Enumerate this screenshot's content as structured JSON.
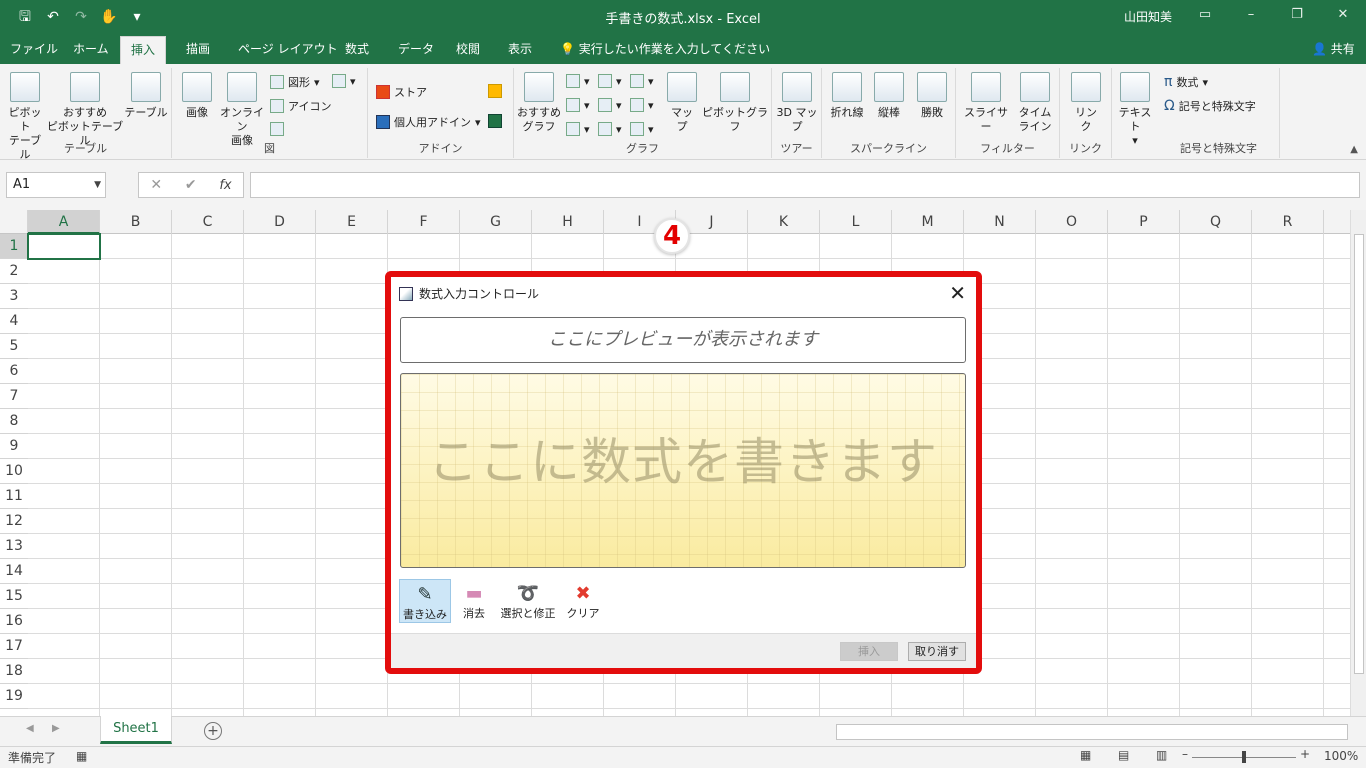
{
  "titlebar": {
    "title": "手書きの数式.xlsx  -  Excel",
    "user": "山田知美"
  },
  "tabs": [
    "ファイル",
    "ホーム",
    "挿入",
    "描画",
    "ページ レイアウト",
    "数式",
    "データ",
    "校閲",
    "表示"
  ],
  "tellme": "実行したい作業を入力してください",
  "share": "共有",
  "ribbon": {
    "groups": {
      "table": "テーブル",
      "illustrations": "図",
      "addins": "アドイン",
      "charts": "グラフ",
      "tours": "ツアー",
      "sparklines": "スパークライン",
      "filters": "フィルター",
      "links": "リンク",
      "symbols": "記号と特殊文字"
    },
    "buttons": {
      "pivot": "ピボット\nテーブル",
      "recpivot": "おすすめ\nピボットテーブル",
      "table": "テーブル",
      "picture": "画像",
      "online": "オンライン\n画像",
      "shapes": "図形",
      "icons": "アイコン",
      "store": "ストア",
      "myaddins": "個人用アドイン",
      "recchart": "おすすめ\nグラフ",
      "map": "マッ\nプ",
      "pivotchart": "ピボットグラフ",
      "map3d": "3D マッ\nプ",
      "line": "折れ線",
      "column": "縦棒",
      "winloss": "勝敗",
      "slicer": "スライサー",
      "timeline": "タイム\nライン",
      "link": "リン\nク",
      "text": "テキスト",
      "equation": "数式",
      "symbol": "記号と特殊文字"
    }
  },
  "formulabar": {
    "namebox": "A1",
    "fx": "fx"
  },
  "columns": [
    "A",
    "B",
    "C",
    "D",
    "E",
    "F",
    "G",
    "H",
    "I",
    "J",
    "K",
    "L",
    "M",
    "N",
    "O",
    "P",
    "Q",
    "R"
  ],
  "rows": [
    "1",
    "2",
    "3",
    "4",
    "5",
    "6",
    "7",
    "8",
    "9",
    "10",
    "11",
    "12",
    "13",
    "14",
    "15",
    "16",
    "17",
    "18",
    "19"
  ],
  "callout": "4",
  "dialog": {
    "title": "数式入力コントロール",
    "preview": "ここにプレビューが表示されます",
    "pad": "ここに数式を書きます",
    "tools": [
      "書き込み",
      "消去",
      "選択と修正",
      "クリア"
    ],
    "insert": "挿入",
    "cancel": "取り消す"
  },
  "sheet": {
    "tab": "Sheet1"
  },
  "status": {
    "ready": "準備完了",
    "zoom": "100%"
  },
  "colors": {
    "excel_green": "#217346",
    "annotation_red": "#e30d0d"
  }
}
